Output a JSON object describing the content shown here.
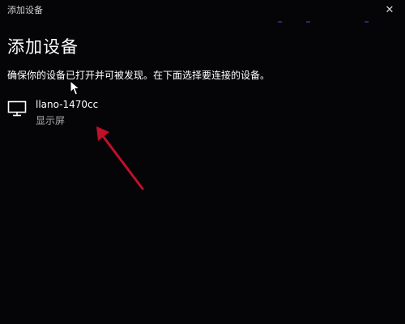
{
  "window": {
    "title": "添加设备",
    "close_glyph": "✕"
  },
  "main": {
    "title": "添加设备",
    "instructions": "确保你的设备已打开并可被发现。在下面选择要连接的设备。"
  },
  "devices": [
    {
      "name": "llano-1470cc",
      "type": "显示屏",
      "icon": "monitor-icon"
    }
  ],
  "colors": {
    "background": "#050507",
    "text": "#ffffff",
    "secondary_text": "#a8a8a8",
    "annotation_arrow": "#c0102a"
  }
}
